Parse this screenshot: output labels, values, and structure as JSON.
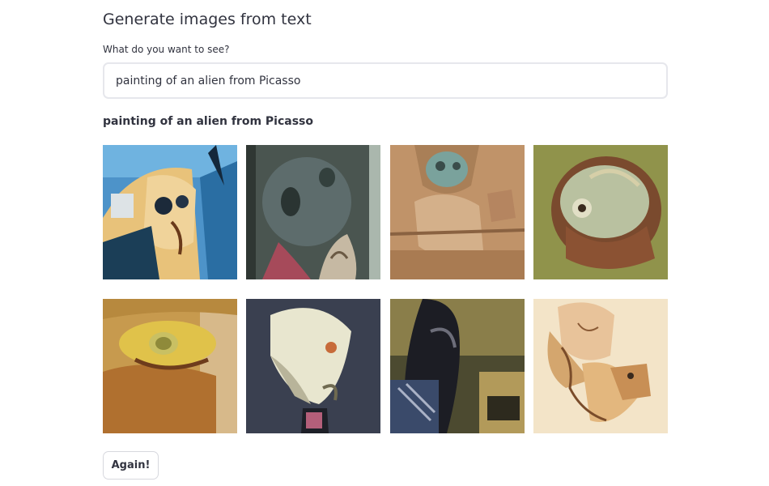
{
  "header": {
    "title": "Generate images from text"
  },
  "prompt_input": {
    "label": "What do you want to see?",
    "value": "painting of an alien from Picasso"
  },
  "results": {
    "caption": "painting of an alien from Picasso",
    "image_count": 8
  },
  "actions": {
    "again_label": "Again!"
  }
}
